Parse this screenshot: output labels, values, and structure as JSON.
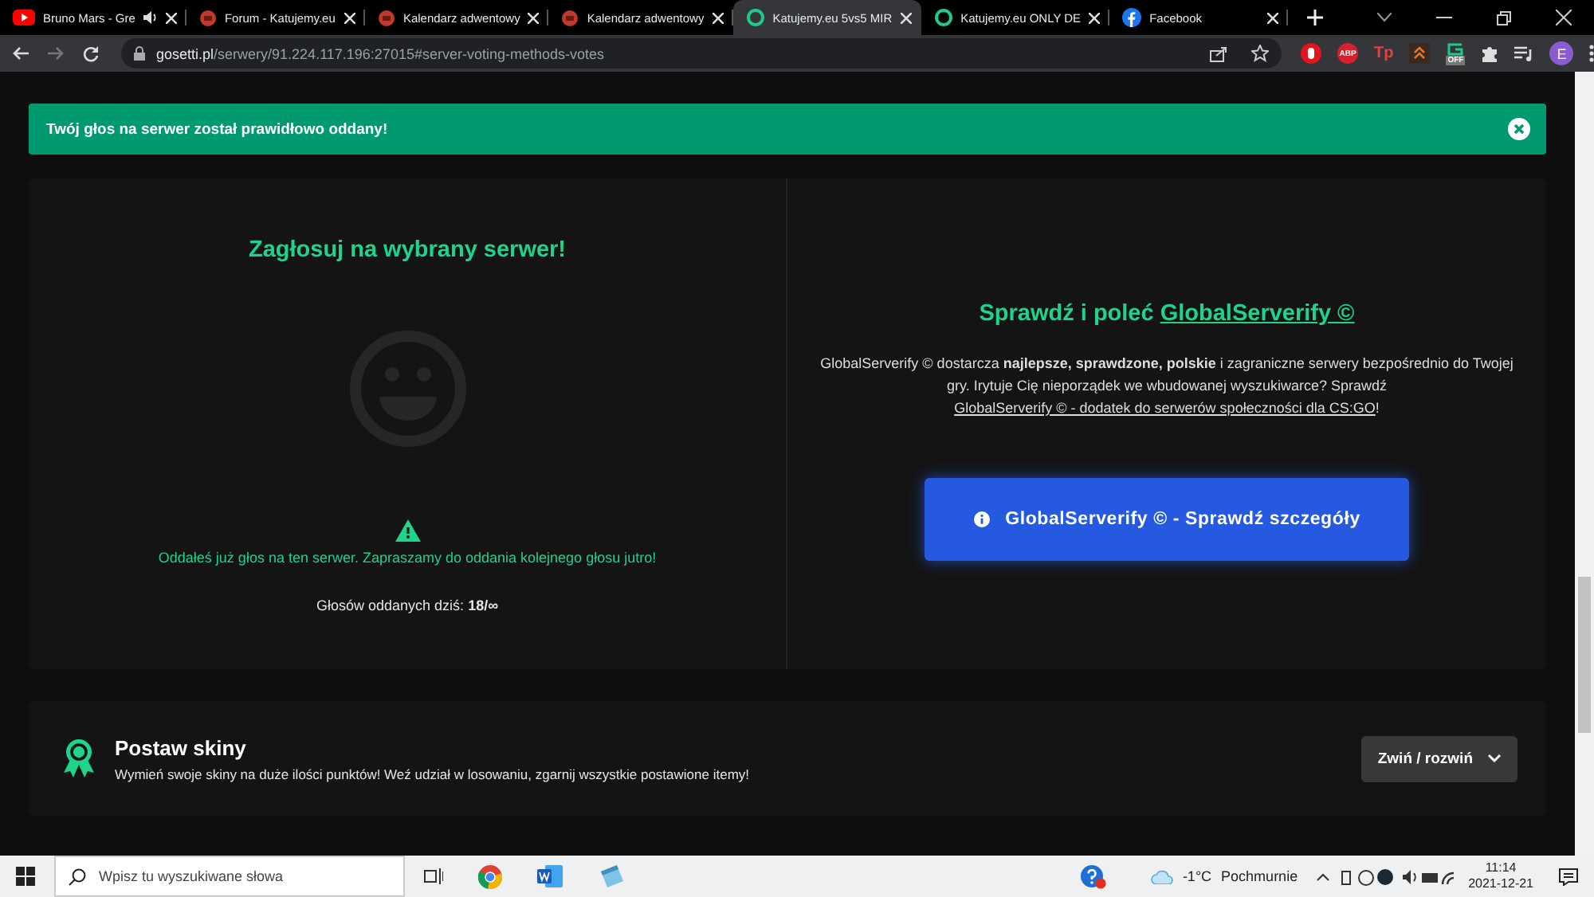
{
  "browser": {
    "tabs": [
      {
        "title": "Bruno Mars - Gre",
        "kind": "youtube",
        "audio": true,
        "selected": false
      },
      {
        "title": "Forum - Katujemy.eu",
        "kind": "forum",
        "audio": false,
        "selected": false
      },
      {
        "title": "Kalendarz adwentowy",
        "kind": "forum",
        "audio": false,
        "selected": false
      },
      {
        "title": "Kalendarz adwentowy",
        "kind": "forum",
        "audio": false,
        "selected": false
      },
      {
        "title": "Katujemy.eu 5vs5 MIR",
        "kind": "ring",
        "audio": false,
        "selected": true
      },
      {
        "title": "Katujemy.eu ONLY DE",
        "kind": "ring",
        "audio": false,
        "selected": false
      },
      {
        "title": "Facebook",
        "kind": "facebook",
        "audio": false,
        "selected": false
      }
    ],
    "address": {
      "domain": "gosetti.pl",
      "path": "/serwery/91.224.117.196:27015#server-voting-methods-votes"
    },
    "extensions": [
      {
        "kind": "record"
      },
      {
        "kind": "octagon",
        "label": "ABP"
      },
      {
        "kind": "letters",
        "label": "Tp"
      },
      {
        "kind": "chevrons"
      },
      {
        "kind": "off",
        "label": "OFF"
      },
      {
        "kind": "puzzle"
      },
      {
        "kind": "playlist"
      }
    ],
    "profile": {
      "initial": "E"
    }
  },
  "alert": {
    "message": "Twój głos na serwer został prawidłowo oddany!"
  },
  "vote": {
    "title": "Zagłosuj na wybrany serwer!",
    "message": "Oddałeś już głos na ten serwer. Zapraszamy do oddania kolejnego głosu jutro!",
    "count": "Głosów oddanych dziś: **18/∞**"
  },
  "promo": {
    "title": "Sprawdź i poleć",
    "title_link": "GlobalServerify ©",
    "text": "GlobalServerify © dostarcza **najlepsze, sprawdzone, polskie** i zagraniczne serwery bezpośrednio do Twojej gry. Irytuje Cię nieporządek we wbudowanej wyszukiwarce? Sprawdź",
    "link": "GlobalServerify © - dodatek do serwerów społeczności dla CS:GO",
    "suffix": "!",
    "button": "GlobalServerify © - Sprawdź szczegóły"
  },
  "skins": {
    "title": "Postaw skiny",
    "description": "Wymień swoje skiny na duże ilości punktów! Weź udział w losowaniu, zgarnij wszystkie postawione itemy!",
    "button": "Zwiń / rozwiń"
  },
  "taskbar": {
    "search_placeholder": "Wpisz tu wyszukiwane słowa",
    "temperature": "-1°C",
    "weather": "Pochmurnie",
    "time": "11:14",
    "date": "2021-12-21"
  }
}
